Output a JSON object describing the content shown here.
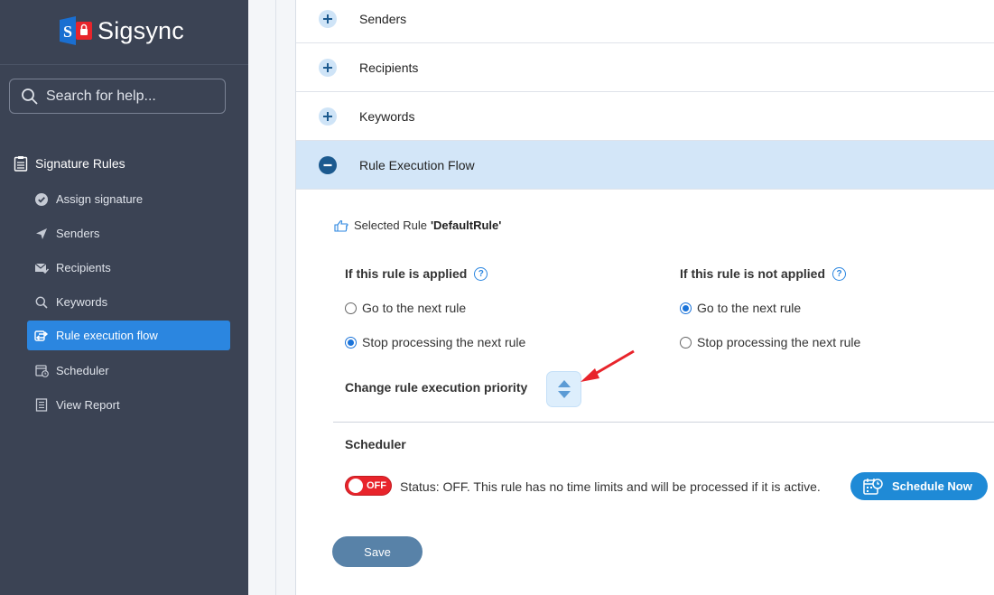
{
  "app": {
    "name": "Sigsync"
  },
  "search": {
    "placeholder": "Search for help..."
  },
  "sidebar": {
    "section": "Signature Rules",
    "items": [
      {
        "label": "Assign signature",
        "icon": "check-circle-icon"
      },
      {
        "label": "Senders",
        "icon": "paper-plane-icon"
      },
      {
        "label": "Recipients",
        "icon": "mail-check-icon"
      },
      {
        "label": "Keywords",
        "icon": "search-icon"
      },
      {
        "label": "Rule execution flow",
        "icon": "flow-icon",
        "active": true
      },
      {
        "label": "Scheduler",
        "icon": "calendar-clock-icon"
      },
      {
        "label": "View Report",
        "icon": "report-icon"
      }
    ]
  },
  "accordion": {
    "senders": "Senders",
    "recipients": "Recipients",
    "keywords": "Keywords",
    "flow": "Rule Execution Flow"
  },
  "flow": {
    "selected_prefix": "Selected Rule",
    "selected_rule": "'DefaultRule'",
    "applied": {
      "title": "If this rule is applied",
      "options": [
        "Go to the next rule",
        "Stop processing the next rule"
      ],
      "selected": 1
    },
    "not_applied": {
      "title": "If this rule is not applied",
      "options": [
        "Go to the next rule",
        "Stop processing the next rule"
      ],
      "selected": 0
    },
    "priority_label": "Change rule execution priority"
  },
  "scheduler": {
    "title": "Scheduler",
    "toggle_label": "OFF",
    "status": "Status: OFF. This rule has no time limits and will be processed if it is active.",
    "button": "Schedule Now"
  },
  "actions": {
    "save": "Save"
  },
  "colors": {
    "sidebar_bg": "#3b4354",
    "active_item": "#2b86e0",
    "accordion_open": "#d3e6f8",
    "off_toggle": "#e8242b",
    "save_button": "#5882a8",
    "annotation_arrow": "#e8242b"
  }
}
